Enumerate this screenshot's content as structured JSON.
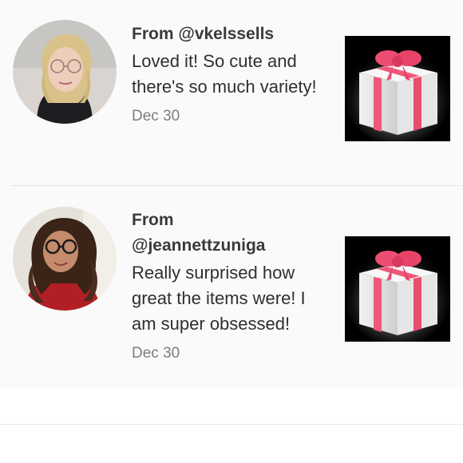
{
  "reviews": [
    {
      "from_prefix": "From",
      "handle": "@vkelssells",
      "message": "Loved it! So cute and there's so much variety!",
      "date": "Dec 30",
      "avatar_icon": "user-photo-avatar",
      "gift_icon": "gift-box-icon"
    },
    {
      "from_prefix": "From",
      "handle": "@jeannettzuniga",
      "message": "Really surprised how great the items were! I am super obsessed!",
      "date": "Dec 30",
      "avatar_icon": "user-photo-avatar",
      "gift_icon": "gift-box-icon"
    }
  ],
  "colors": {
    "text": "#2f2f2f",
    "muted": "#7c7c7c",
    "ribbon": "#f04a6d",
    "gift_bg": "#000000"
  }
}
